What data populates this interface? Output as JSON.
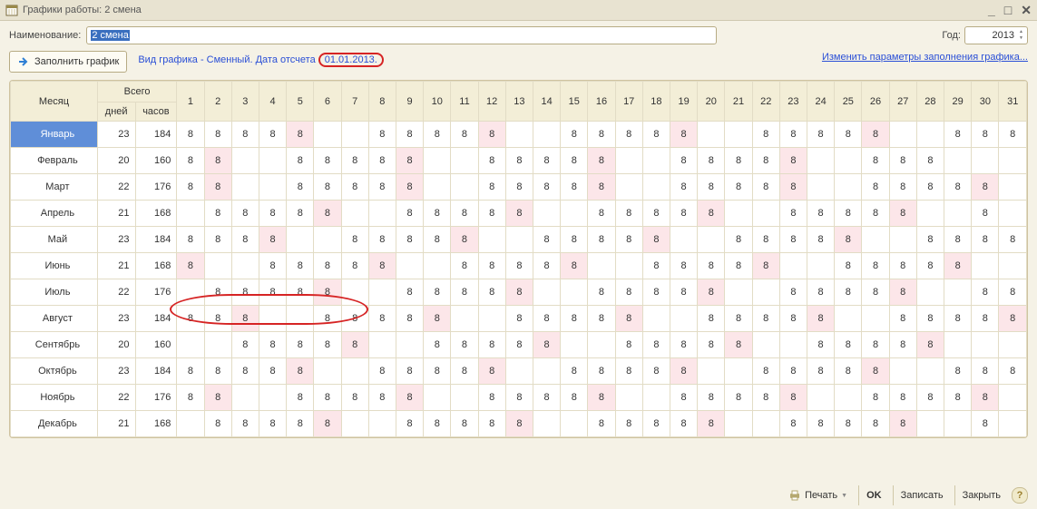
{
  "title": "Графики работы: 2 смена",
  "name_label": "Наименование:",
  "name_value": "2 смена",
  "year_label": "Год:",
  "year_value": "2013",
  "fill_button": "Заполнить график",
  "desc_prefix": "Вид графика - Сменный. Дата отсчета ",
  "desc_date": "01.01.2013.",
  "link_params": "Изменить параметры заполнения графика...",
  "headers": {
    "month": "Месяц",
    "total": "Всего",
    "days": "дней",
    "hours": "часов"
  },
  "day_cols": [
    "1",
    "2",
    "3",
    "4",
    "5",
    "6",
    "7",
    "8",
    "9",
    "10",
    "11",
    "12",
    "13",
    "14",
    "15",
    "16",
    "17",
    "18",
    "19",
    "20",
    "21",
    "22",
    "23",
    "24",
    "25",
    "26",
    "27",
    "28",
    "29",
    "30",
    "31"
  ],
  "months": [
    "Январь",
    "Февраль",
    "Март",
    "Апрель",
    "Май",
    "Июнь",
    "Июль",
    "Август",
    "Сентябрь",
    "Октябрь",
    "Ноябрь",
    "Декабрь"
  ],
  "totals_days": [
    23,
    20,
    22,
    21,
    23,
    21,
    22,
    23,
    20,
    23,
    22,
    21
  ],
  "totals_hours": [
    184,
    160,
    176,
    168,
    184,
    168,
    176,
    184,
    160,
    184,
    176,
    168
  ],
  "grid_values": [
    [
      "8",
      "8",
      "8",
      "8",
      "8",
      "",
      "",
      "8",
      "8",
      "8",
      "8",
      "8",
      "",
      "",
      "8",
      "8",
      "8",
      "8",
      "8",
      "",
      "",
      "8",
      "8",
      "8",
      "8",
      "8",
      "",
      "",
      "8",
      "8",
      "8"
    ],
    [
      "8",
      "8",
      "",
      "",
      "8",
      "8",
      "8",
      "8",
      "8",
      "",
      "",
      "8",
      "8",
      "8",
      "8",
      "8",
      "",
      "",
      "8",
      "8",
      "8",
      "8",
      "8",
      "",
      "",
      "8",
      "8",
      "8",
      "",
      "",
      ""
    ],
    [
      "8",
      "8",
      "",
      "",
      "8",
      "8",
      "8",
      "8",
      "8",
      "",
      "",
      "8",
      "8",
      "8",
      "8",
      "8",
      "",
      "",
      "8",
      "8",
      "8",
      "8",
      "8",
      "",
      "",
      "8",
      "8",
      "8",
      "8",
      "8",
      ""
    ],
    [
      "",
      "8",
      "8",
      "8",
      "8",
      "8",
      "",
      "",
      "8",
      "8",
      "8",
      "8",
      "8",
      "",
      "",
      "8",
      "8",
      "8",
      "8",
      "8",
      "",
      "",
      "8",
      "8",
      "8",
      "8",
      "8",
      "",
      "",
      "8",
      ""
    ],
    [
      "8",
      "8",
      "8",
      "8",
      "",
      "",
      "8",
      "8",
      "8",
      "8",
      "8",
      "",
      "",
      "8",
      "8",
      "8",
      "8",
      "8",
      "",
      "",
      "8",
      "8",
      "8",
      "8",
      "8",
      "",
      "",
      "8",
      "8",
      "8",
      "8"
    ],
    [
      "8",
      "",
      "",
      "8",
      "8",
      "8",
      "8",
      "8",
      "",
      "",
      "8",
      "8",
      "8",
      "8",
      "8",
      "",
      "",
      "8",
      "8",
      "8",
      "8",
      "8",
      "",
      "",
      "8",
      "8",
      "8",
      "8",
      "8",
      "",
      ""
    ],
    [
      "",
      "8",
      "8",
      "8",
      "8",
      "8",
      "",
      "",
      "8",
      "8",
      "8",
      "8",
      "8",
      "",
      "",
      "8",
      "8",
      "8",
      "8",
      "8",
      "",
      "",
      "8",
      "8",
      "8",
      "8",
      "8",
      "",
      "",
      "8",
      "8"
    ],
    [
      "8",
      "8",
      "8",
      "",
      "",
      "8",
      "8",
      "8",
      "8",
      "8",
      "",
      "",
      "8",
      "8",
      "8",
      "8",
      "8",
      "",
      "",
      "8",
      "8",
      "8",
      "8",
      "8",
      "",
      "",
      "8",
      "8",
      "8",
      "8",
      "8"
    ],
    [
      "",
      "",
      "8",
      "8",
      "8",
      "8",
      "8",
      "",
      "",
      "8",
      "8",
      "8",
      "8",
      "8",
      "",
      "",
      "8",
      "8",
      "8",
      "8",
      "8",
      "",
      "",
      "8",
      "8",
      "8",
      "8",
      "8",
      "",
      "",
      ""
    ],
    [
      "8",
      "8",
      "8",
      "8",
      "8",
      "",
      "",
      "8",
      "8",
      "8",
      "8",
      "8",
      "",
      "",
      "8",
      "8",
      "8",
      "8",
      "8",
      "",
      "",
      "8",
      "8",
      "8",
      "8",
      "8",
      "",
      "",
      "8",
      "8",
      "8"
    ],
    [
      "8",
      "8",
      "",
      "",
      "8",
      "8",
      "8",
      "8",
      "8",
      "",
      "",
      "8",
      "8",
      "8",
      "8",
      "8",
      "",
      "",
      "8",
      "8",
      "8",
      "8",
      "8",
      "",
      "",
      "8",
      "8",
      "8",
      "8",
      "8",
      ""
    ],
    [
      "",
      "8",
      "8",
      "8",
      "8",
      "8",
      "",
      "",
      "8",
      "8",
      "8",
      "8",
      "8",
      "",
      "",
      "8",
      "8",
      "8",
      "8",
      "8",
      "",
      "",
      "8",
      "8",
      "8",
      "8",
      "8",
      "",
      "",
      "8",
      ""
    ]
  ],
  "grid_pink": [
    [
      0,
      0,
      0,
      0,
      1,
      0,
      0,
      0,
      0,
      0,
      0,
      1,
      0,
      0,
      0,
      0,
      0,
      0,
      1,
      0,
      0,
      0,
      0,
      0,
      0,
      1,
      0,
      0,
      0,
      0,
      0
    ],
    [
      0,
      1,
      0,
      0,
      0,
      0,
      0,
      0,
      1,
      0,
      0,
      0,
      0,
      0,
      0,
      1,
      0,
      0,
      0,
      0,
      0,
      0,
      1,
      0,
      0,
      0,
      0,
      0,
      0,
      0,
      0
    ],
    [
      0,
      1,
      0,
      0,
      0,
      0,
      0,
      0,
      1,
      0,
      0,
      0,
      0,
      0,
      0,
      1,
      0,
      0,
      0,
      0,
      0,
      0,
      1,
      0,
      0,
      0,
      0,
      0,
      0,
      1,
      0
    ],
    [
      0,
      0,
      0,
      0,
      0,
      1,
      0,
      0,
      0,
      0,
      0,
      0,
      1,
      0,
      0,
      0,
      0,
      0,
      0,
      1,
      0,
      0,
      0,
      0,
      0,
      0,
      1,
      0,
      0,
      0,
      0
    ],
    [
      0,
      0,
      0,
      1,
      0,
      0,
      0,
      0,
      0,
      0,
      1,
      0,
      0,
      0,
      0,
      0,
      0,
      1,
      0,
      0,
      0,
      0,
      0,
      0,
      1,
      0,
      0,
      0,
      0,
      0,
      0
    ],
    [
      1,
      0,
      0,
      0,
      0,
      0,
      0,
      1,
      0,
      0,
      0,
      0,
      0,
      0,
      1,
      0,
      0,
      0,
      0,
      0,
      0,
      1,
      0,
      0,
      0,
      0,
      0,
      0,
      1,
      0,
      0
    ],
    [
      0,
      0,
      0,
      0,
      0,
      1,
      0,
      0,
      0,
      0,
      0,
      0,
      1,
      0,
      0,
      0,
      0,
      0,
      0,
      1,
      0,
      0,
      0,
      0,
      0,
      0,
      1,
      0,
      0,
      0,
      0
    ],
    [
      0,
      0,
      1,
      0,
      0,
      0,
      0,
      0,
      0,
      1,
      0,
      0,
      0,
      0,
      0,
      0,
      1,
      0,
      0,
      0,
      0,
      0,
      0,
      1,
      0,
      0,
      0,
      0,
      0,
      0,
      1
    ],
    [
      0,
      0,
      0,
      0,
      0,
      0,
      1,
      0,
      0,
      0,
      0,
      0,
      0,
      1,
      0,
      0,
      0,
      0,
      0,
      0,
      1,
      0,
      0,
      0,
      0,
      0,
      0,
      1,
      0,
      0,
      0
    ],
    [
      0,
      0,
      0,
      0,
      1,
      0,
      0,
      0,
      0,
      0,
      0,
      1,
      0,
      0,
      0,
      0,
      0,
      0,
      1,
      0,
      0,
      0,
      0,
      0,
      0,
      1,
      0,
      0,
      0,
      0,
      0
    ],
    [
      0,
      1,
      0,
      0,
      0,
      0,
      0,
      0,
      1,
      0,
      0,
      0,
      0,
      0,
      0,
      1,
      0,
      0,
      0,
      0,
      0,
      0,
      1,
      0,
      0,
      0,
      0,
      0,
      0,
      1,
      0
    ],
    [
      0,
      0,
      0,
      0,
      0,
      1,
      0,
      0,
      0,
      0,
      0,
      0,
      1,
      0,
      0,
      0,
      0,
      0,
      0,
      1,
      0,
      0,
      0,
      0,
      0,
      0,
      1,
      0,
      0,
      0,
      0
    ]
  ],
  "footer": {
    "print": "Печать",
    "ok": "OK",
    "save": "Записать",
    "close": "Закрыть"
  }
}
